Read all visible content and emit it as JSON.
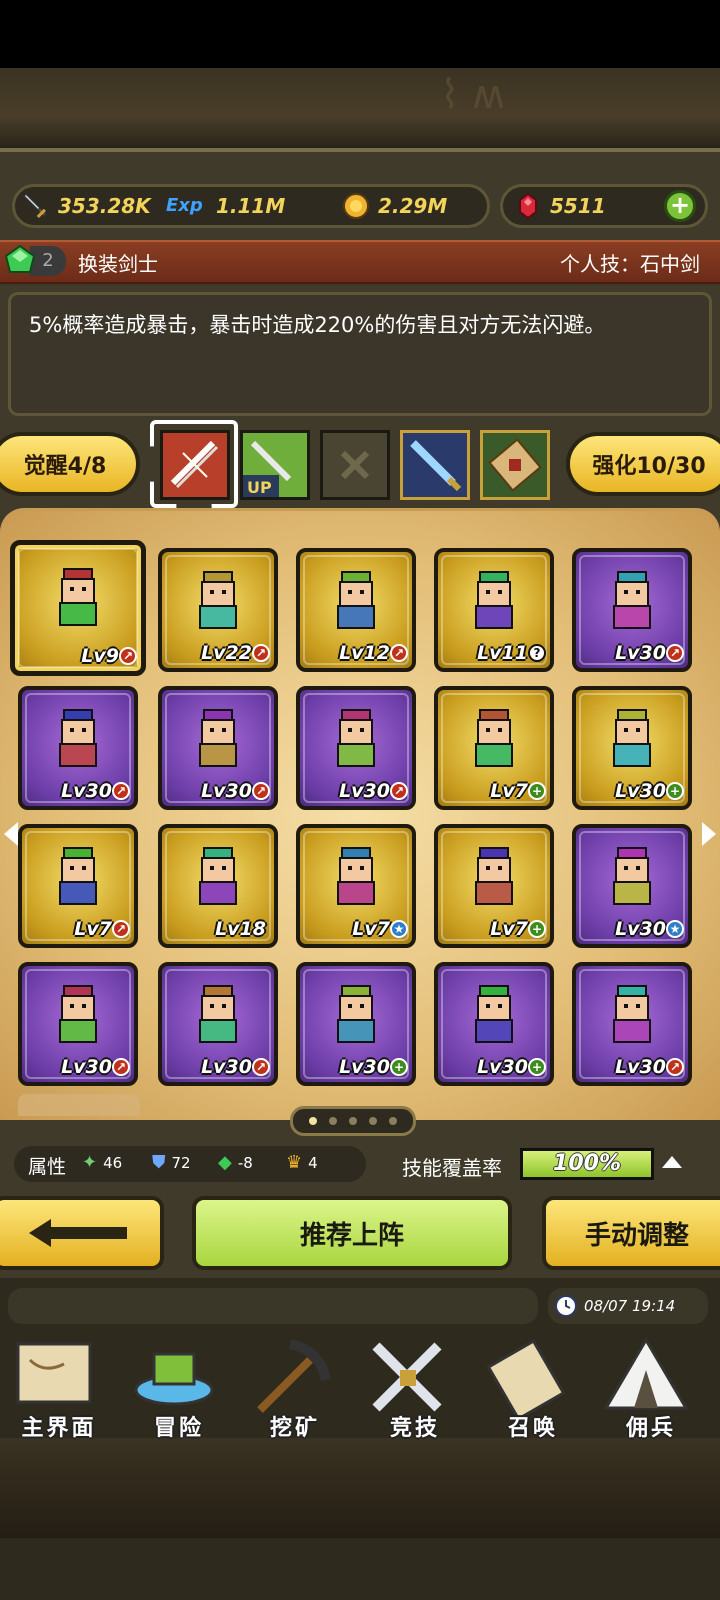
{
  "resources": {
    "attack": "353.28K",
    "exp": "1.11M",
    "gold": "2.29M",
    "gems": "5511"
  },
  "hero_title": {
    "count": "2",
    "name": "换装剑士",
    "skill": "个人技：石中剑"
  },
  "description": "5%概率造成暴击，暴击时造成220%的伤害且对方无法闪避。",
  "awaken": {
    "label": "觉醒4/8"
  },
  "enhance": {
    "label": "强化10/30"
  },
  "skills": [
    {
      "icon": "sword-slash-icon"
    },
    {
      "icon": "sword-up-icon",
      "tag": "UP"
    },
    {
      "icon": "locked-x-icon"
    },
    {
      "icon": "crystal-sword-icon"
    },
    {
      "icon": "scroll-bundle-icon"
    }
  ],
  "heroes": [
    {
      "lv": "Lv9",
      "rarity": "gold",
      "badge": "red"
    },
    {
      "lv": "Lv22",
      "rarity": "gold",
      "badge": "red"
    },
    {
      "lv": "Lv12",
      "rarity": "gold",
      "badge": "red"
    },
    {
      "lv": "Lv11",
      "rarity": "gold",
      "badge": "white"
    },
    {
      "lv": "Lv30",
      "rarity": "purple",
      "badge": "red"
    },
    {
      "lv": "Lv30",
      "rarity": "purple",
      "badge": "red"
    },
    {
      "lv": "Lv30",
      "rarity": "purple",
      "badge": "red"
    },
    {
      "lv": "Lv30",
      "rarity": "purple",
      "badge": "red"
    },
    {
      "lv": "Lv7",
      "rarity": "gold",
      "badge": "green"
    },
    {
      "lv": "Lv30",
      "rarity": "gold",
      "badge": "green"
    },
    {
      "lv": "Lv7",
      "rarity": "gold",
      "badge": "red"
    },
    {
      "lv": "Lv18",
      "rarity": "gold",
      "badge": ""
    },
    {
      "lv": "Lv7",
      "rarity": "gold",
      "badge": "blue"
    },
    {
      "lv": "Lv7",
      "rarity": "gold",
      "badge": "green"
    },
    {
      "lv": "Lv30",
      "rarity": "purple",
      "badge": "blue"
    },
    {
      "lv": "Lv30",
      "rarity": "purple",
      "badge": "red"
    },
    {
      "lv": "Lv30",
      "rarity": "purple",
      "badge": "red"
    },
    {
      "lv": "Lv30",
      "rarity": "purple",
      "badge": "green"
    },
    {
      "lv": "Lv30",
      "rarity": "purple",
      "badge": "green"
    },
    {
      "lv": "Lv30",
      "rarity": "purple",
      "badge": "red"
    }
  ],
  "attributes": {
    "label": "属性",
    "agility": "46",
    "defense": "72",
    "attack": "-8",
    "crown": "4"
  },
  "coverage": {
    "label": "技能覆盖率",
    "value": "100%",
    "fraction": 1.0
  },
  "actions": {
    "recommend": "推荐上阵",
    "manual": "手动调整"
  },
  "timestamp": "08/07 19:14",
  "nav": [
    {
      "label": "主界面",
      "icon": "map-scroll-icon"
    },
    {
      "label": "冒险",
      "icon": "island-icon"
    },
    {
      "label": "挖矿",
      "icon": "pickaxe-icon"
    },
    {
      "label": "竞技",
      "icon": "crossed-swords-icon"
    },
    {
      "label": "召唤",
      "icon": "summon-scroll-icon"
    },
    {
      "label": "佣兵",
      "icon": "tent-icon"
    }
  ],
  "colors": {
    "gold_card": "#e6c23a",
    "purple_card": "#7c46b8",
    "accent_yellow": "#f3d45a",
    "green_button": "#b9e05a"
  }
}
